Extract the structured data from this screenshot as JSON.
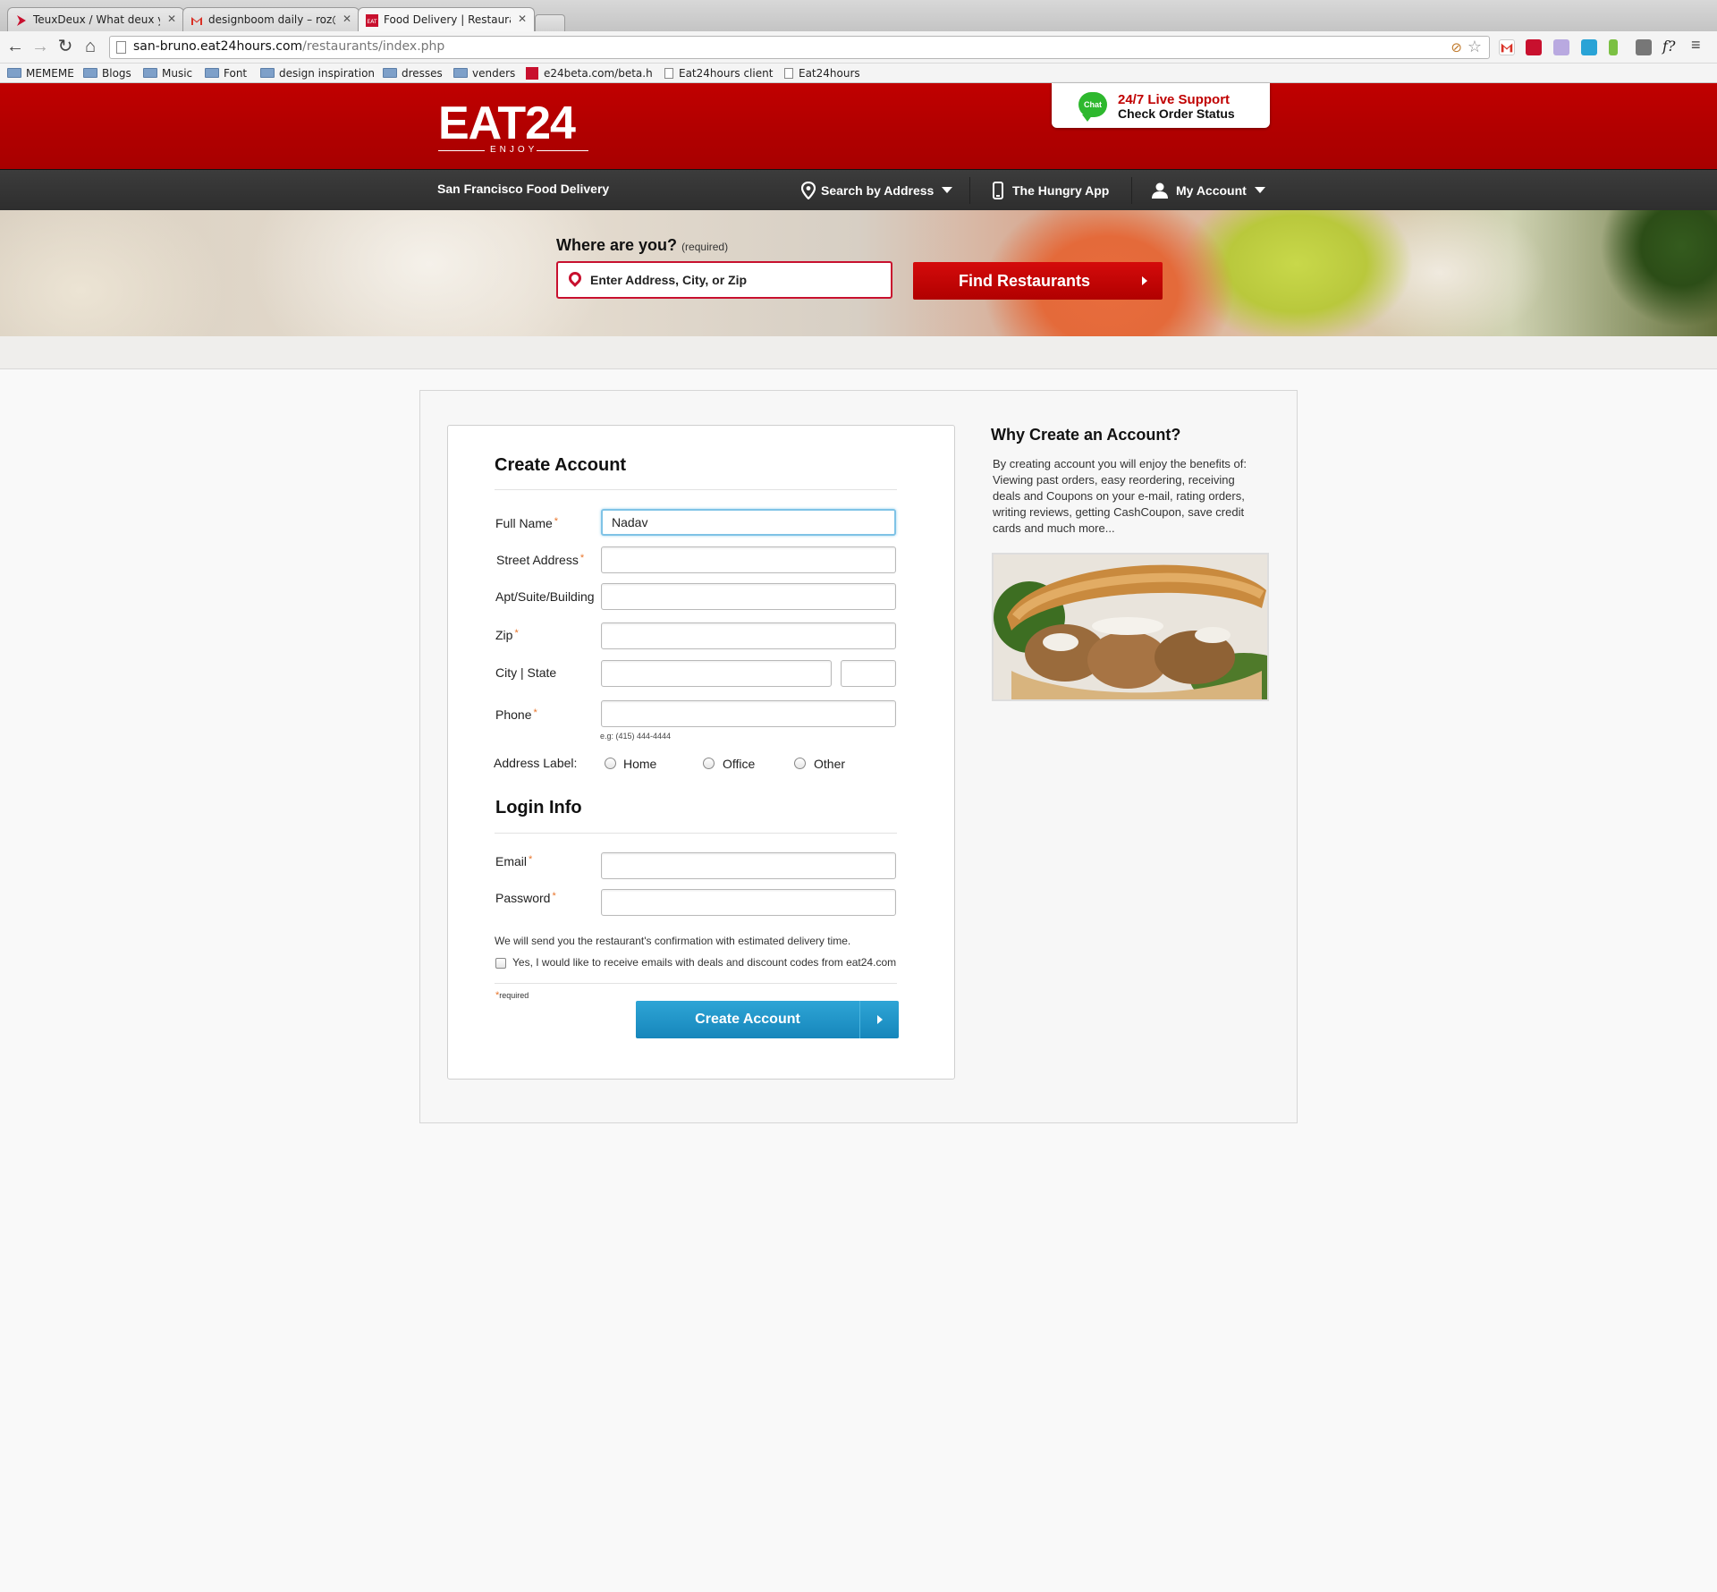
{
  "browser": {
    "tabs": [
      {
        "title": "TeuxDeux / What deux you",
        "active": false
      },
      {
        "title": "designboom daily – roz@e",
        "active": false
      },
      {
        "title": "Food Delivery | Restaurant",
        "active": true
      }
    ],
    "url_host": "san-bruno.eat24hours.com",
    "url_path": "/restaurants/index.php",
    "bookmarks": [
      {
        "label": "MEMEME",
        "icon": "folder-icon"
      },
      {
        "label": "Blogs",
        "icon": "folder-icon"
      },
      {
        "label": "Music",
        "icon": "folder-icon"
      },
      {
        "label": "Font",
        "icon": "folder-icon"
      },
      {
        "label": "design inspiration",
        "icon": "folder-icon"
      },
      {
        "label": "dresses",
        "icon": "folder-icon"
      },
      {
        "label": "venders",
        "icon": "folder-icon"
      },
      {
        "label": "e24beta.com/beta.h",
        "icon": "eat24-favicon"
      },
      {
        "label": "Eat24hours client",
        "icon": "page-icon"
      },
      {
        "label": "Eat24hours",
        "icon": "page-icon"
      }
    ]
  },
  "header": {
    "logo_text": "EAT24",
    "logo_tagline": "ENJOY",
    "support_badge": "Chat",
    "support_title": "24/7 Live Support",
    "support_subtitle": "Check Order Status",
    "city_label": "San Francisco Food Delivery",
    "nav": {
      "search_by_address": "Search by Address",
      "hungry_app": "The Hungry App",
      "my_account": "My Account"
    }
  },
  "hero": {
    "where_label": "Where are you?",
    "where_required": "(required)",
    "address_placeholder": "Enter Address, City, or Zip",
    "find_button": "Find Restaurants"
  },
  "form": {
    "title": "Create Account",
    "full_name_label": "Full Name",
    "full_name_value": "Nadav",
    "street_label": "Street Address",
    "apt_label": "Apt/Suite/Building",
    "zip_label": "Zip",
    "city_state_label": "City | State",
    "phone_label": "Phone",
    "phone_hint": "e.g: (415) 444-4444",
    "address_label_label": "Address Label:",
    "address_label_options": [
      "Home",
      "Office",
      "Other"
    ],
    "login_title": "Login Info",
    "email_label": "Email",
    "password_label": "Password",
    "required_mark": "*",
    "confirmation_note": "We will send you the restaurant's confirmation with estimated delivery time.",
    "optin_label": "Yes, I would like to receive emails with deals and discount codes from eat24.com",
    "required_note": "required",
    "submit_label": "Create Account"
  },
  "sidebar": {
    "title": "Why Create an Account?",
    "text": "By creating account you will enjoy the benefits of: Viewing past orders, easy reordering, receiving deals and Coupons on your e-mail, rating orders, writing reviews, getting CashCoupon, save credit cards and much more..."
  },
  "colors": {
    "brand_red": "#c00000",
    "accent_blue": "#1e95c9",
    "required_orange": "#e8742a"
  }
}
